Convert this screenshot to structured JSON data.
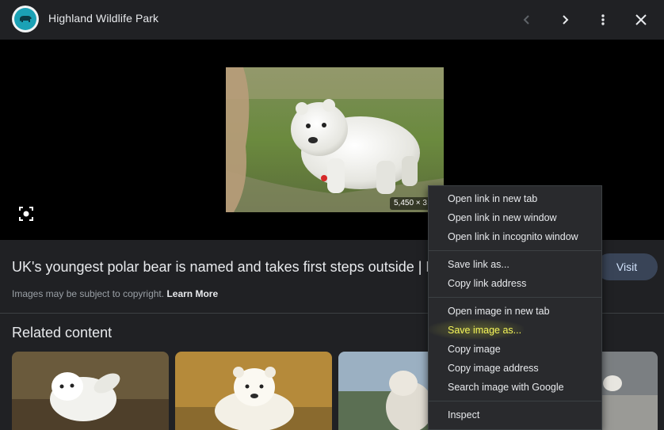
{
  "header": {
    "site_name": "Highland Wildlife Park",
    "logo_icon": "bear-icon",
    "buttons": [
      "previous-icon",
      "next-icon",
      "more-options-icon",
      "close-icon"
    ]
  },
  "viewer": {
    "image_alt": "polar bear cub",
    "dimensions": "5,450 × 3,",
    "lens_icon": "google-lens-icon"
  },
  "info": {
    "title": "UK's youngest polar bear is named and takes first steps outside | H",
    "copyright_text": "Images may be subject to copyright.",
    "learn_more": "Learn More",
    "visit_label": "Visit"
  },
  "related": {
    "heading": "Related content",
    "thumbnails": [
      "polar bear cub rolling",
      "polar bear cub lying",
      "polar bear cub standing",
      "polar bear on rocks"
    ]
  },
  "context_menu": {
    "groups": [
      [
        "Open link in new tab",
        "Open link in new window",
        "Open link in incognito window"
      ],
      [
        "Save link as...",
        "Copy link address"
      ],
      [
        "Open image in new tab",
        "Save image as...",
        "Copy image",
        "Copy image address",
        "Search image with Google"
      ],
      [
        "Inspect"
      ]
    ],
    "highlighted_item": "Save image as..."
  },
  "colors": {
    "background": "#202124",
    "viewer_bg": "#000000",
    "menu_bg": "#292a2d",
    "visit_bg": "#394457",
    "visit_text": "#d2e3fc",
    "logo_accent": "#1ba1b5",
    "highlight_text": "#f5f55a"
  }
}
